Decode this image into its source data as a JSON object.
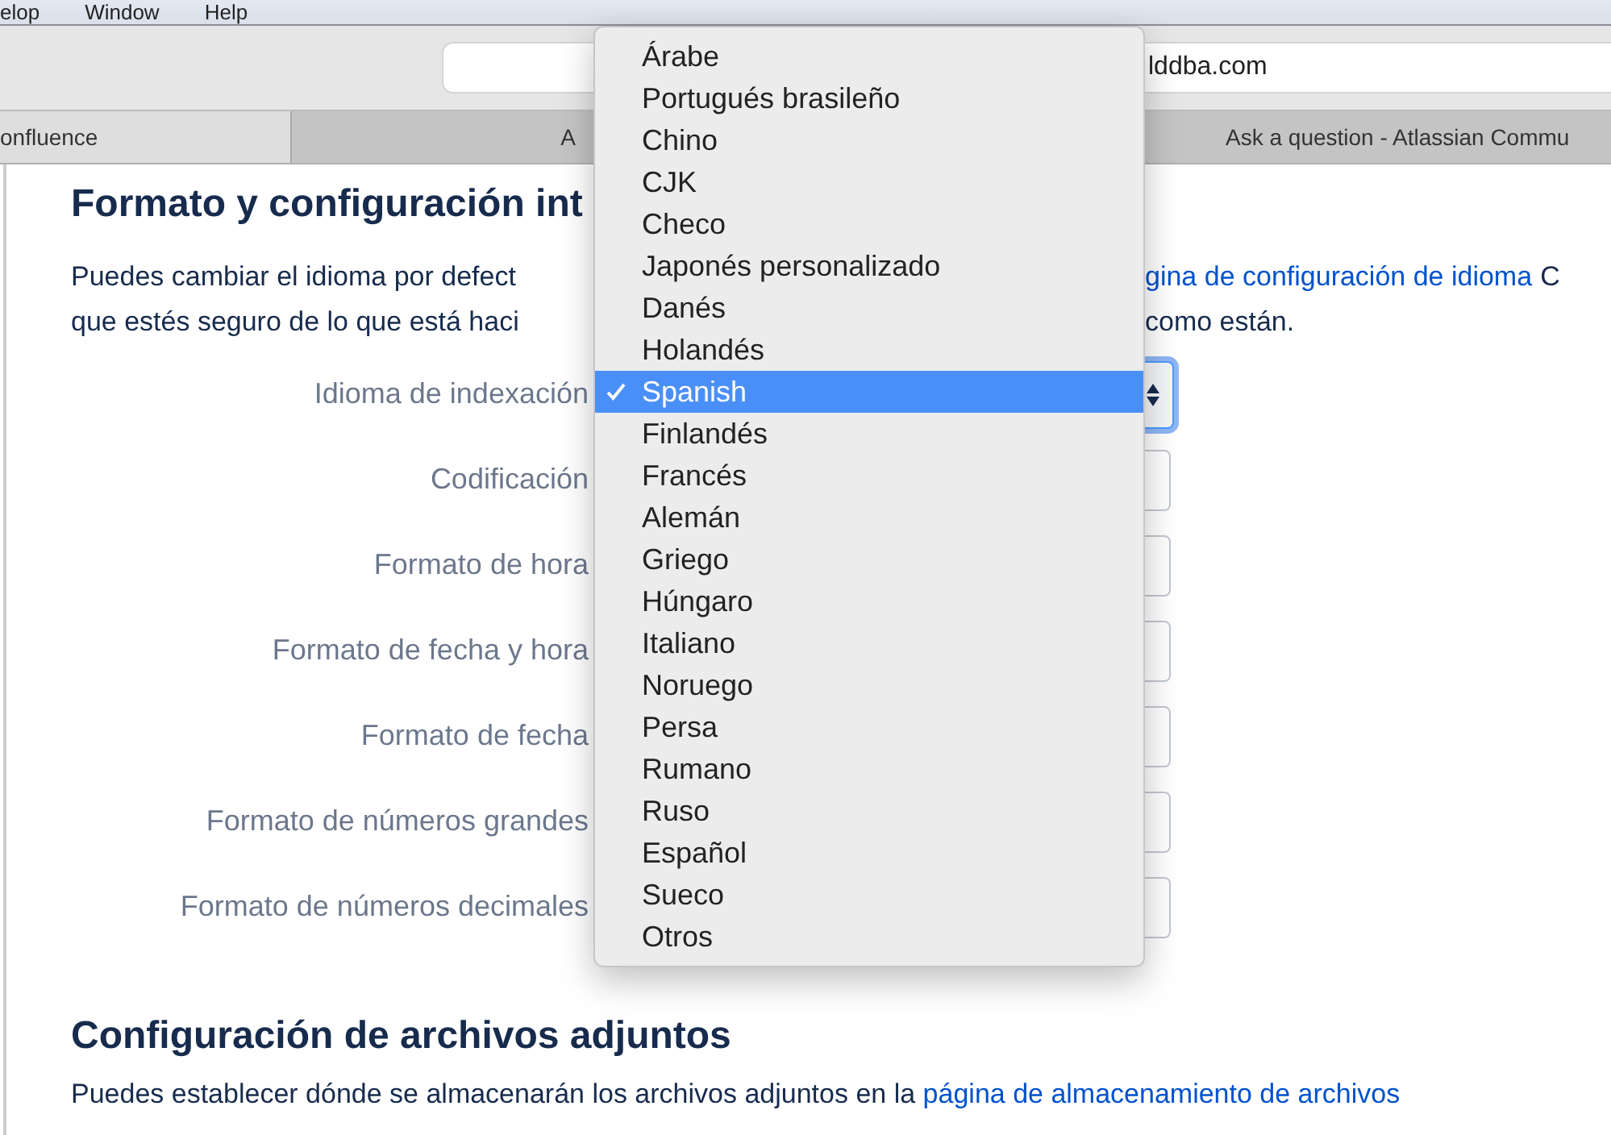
{
  "menu_bar": {
    "items": [
      "elop",
      "Window",
      "Help"
    ]
  },
  "toolbar": {
    "address": "lddba.com"
  },
  "tabs": [
    {
      "label": "onfluence",
      "selected": true
    },
    {
      "label": "A",
      "selected": false
    },
    {
      "label": "Ask a question - Atlassian Commu",
      "selected": false
    }
  ],
  "section1": {
    "heading": "Formato y configuración int",
    "lines": [
      {
        "left": "Puedes cambiar el idioma por defect",
        "link": "gina de configuración de idioma",
        "right": "C"
      },
      {
        "left": "que estés seguro de lo que está haci",
        "right": "como están."
      }
    ]
  },
  "fields": [
    {
      "label": "Idioma de indexación",
      "kind": "select",
      "focused": true
    },
    {
      "label": "Codificación",
      "kind": "input",
      "focused": false
    },
    {
      "label": "Formato de hora",
      "kind": "input",
      "focused": false
    },
    {
      "label": "Formato de fecha y hora",
      "kind": "input",
      "focused": false
    },
    {
      "label": "Formato de fecha",
      "kind": "input",
      "focused": false
    },
    {
      "label": "Formato de números grandes",
      "kind": "input",
      "focused": false
    },
    {
      "label": "Formato de números decimales",
      "kind": "input",
      "focused": false
    }
  ],
  "dropdown": {
    "options": [
      {
        "label": "Árabe",
        "selected": false
      },
      {
        "label": "Portugués brasileño",
        "selected": false
      },
      {
        "label": "Chino",
        "selected": false
      },
      {
        "label": "CJK",
        "selected": false
      },
      {
        "label": "Checo",
        "selected": false
      },
      {
        "label": "Japonés personalizado",
        "selected": false
      },
      {
        "label": "Danés",
        "selected": false
      },
      {
        "label": "Holandés",
        "selected": false
      },
      {
        "label": "Spanish",
        "selected": true
      },
      {
        "label": "Finlandés",
        "selected": false
      },
      {
        "label": "Francés",
        "selected": false
      },
      {
        "label": "Alemán",
        "selected": false
      },
      {
        "label": "Griego",
        "selected": false
      },
      {
        "label": "Húngaro",
        "selected": false
      },
      {
        "label": "Italiano",
        "selected": false
      },
      {
        "label": "Noruego",
        "selected": false
      },
      {
        "label": "Persa",
        "selected": false
      },
      {
        "label": "Rumano",
        "selected": false
      },
      {
        "label": "Ruso",
        "selected": false
      },
      {
        "label": "Español",
        "selected": false
      },
      {
        "label": "Sueco",
        "selected": false
      },
      {
        "label": "Otros",
        "selected": false
      }
    ]
  },
  "section2": {
    "heading": "Configuración de archivos adjuntos",
    "text": "Puedes establecer dónde se almacenarán los archivos adjuntos en la",
    "link": "página de almacenamiento de archivos"
  }
}
